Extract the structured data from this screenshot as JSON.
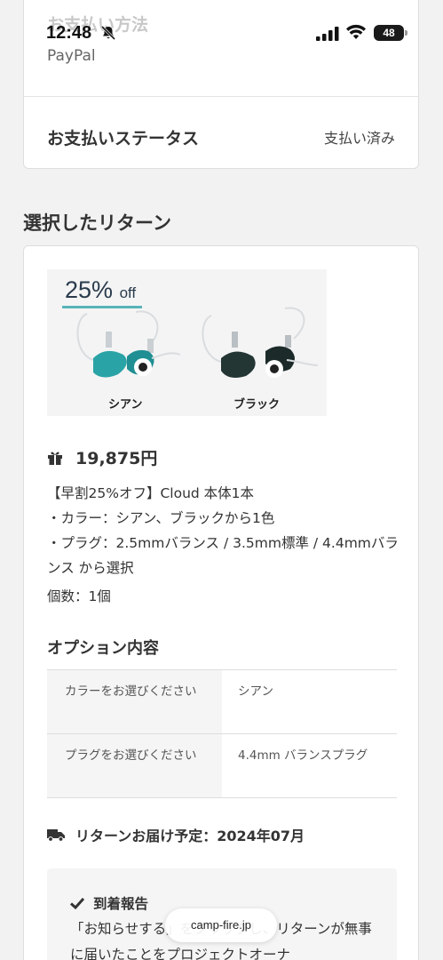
{
  "status_bar": {
    "time": "12:48",
    "battery": "48"
  },
  "payment": {
    "method_label": "お支払い方法",
    "method_value": "PayPal",
    "status_label": "お支払いステータス",
    "status_value": "支払い済み"
  },
  "section_title": "選択したリターン",
  "reward": {
    "image": {
      "badge_number": "25%",
      "badge_suffix": "off",
      "variant_1": "シアン",
      "variant_2": "ブラック"
    },
    "price": "19,875円",
    "description": [
      "【早割25%オフ】Cloud 本体1本",
      "・カラー：シアン、ブラックから1色",
      "・プラグ：2.5mmバランス / 3.5mm標準 / 4.4mmバランス から選択"
    ],
    "quantity": "個数：1個",
    "options_title": "オプション内容",
    "options": [
      {
        "key": "カラーをお選びください",
        "value": "シアン"
      },
      {
        "key": "プラグをお選びください",
        "value": "4.4mm バランスプラグ"
      }
    ],
    "delivery": "リターンお届け予定：2024年07月",
    "report": {
      "title": "到着報告",
      "text": "「お知らせする」をクリックし、リターンが無事に届いたことをプロジェクトオーナ"
    }
  },
  "browser": {
    "url": "camp-fire.jp"
  },
  "icons": {
    "bell": "bell-slash-icon",
    "signal": "signal-icon",
    "wifi": "wifi-icon",
    "gift": "gift-icon",
    "truck": "truck-icon",
    "check": "check-icon"
  },
  "colors": {
    "accent_teal": "#57b4b8",
    "background": "#f2f2f2"
  }
}
